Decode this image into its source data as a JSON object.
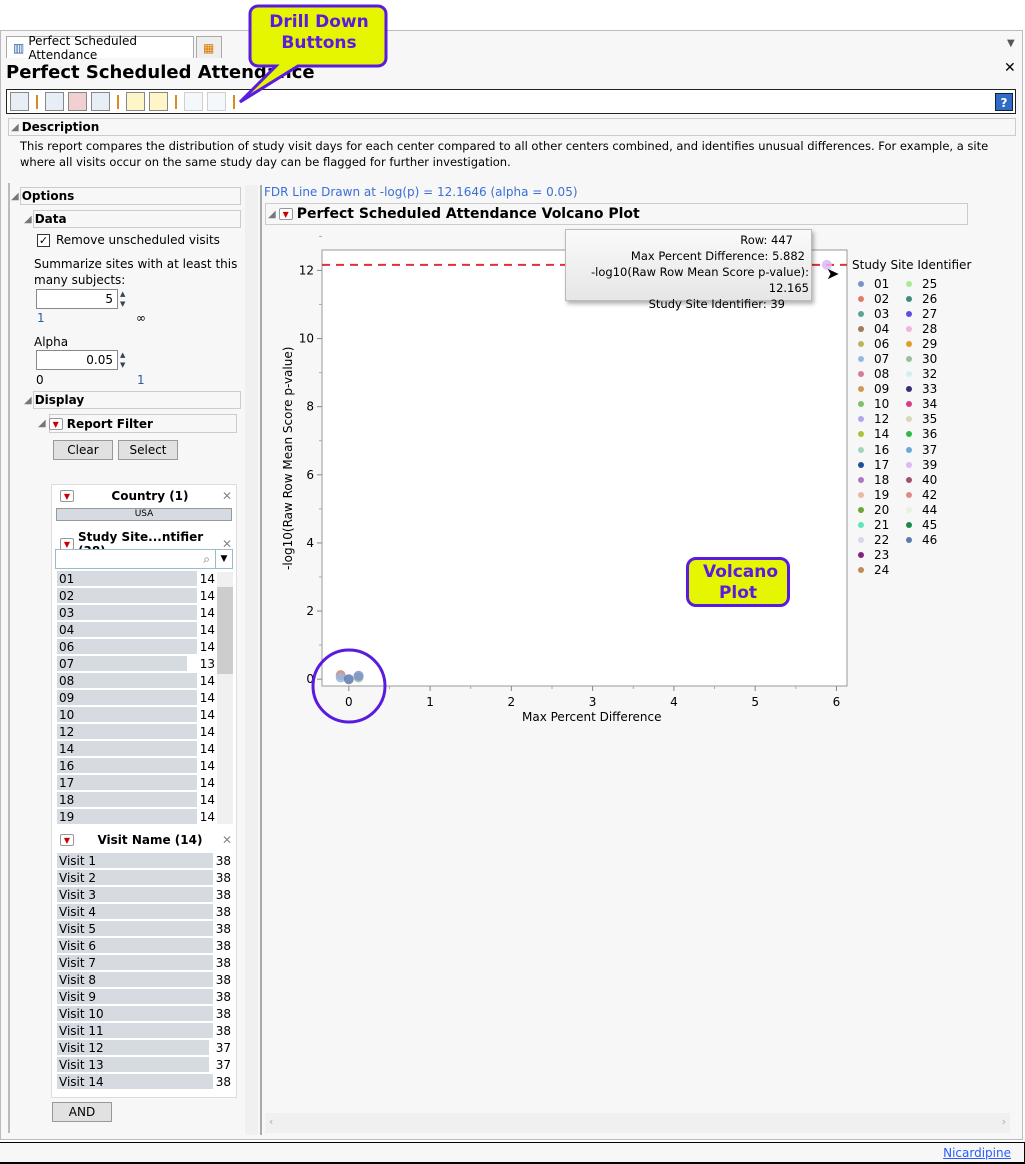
{
  "tabs": [
    {
      "label": "Perfect Scheduled Attendance",
      "icon": "report-icon"
    },
    {
      "label": "",
      "icon": "chart-icon"
    }
  ],
  "title": "Perfect Scheduled Attendance",
  "toolbar": {
    "buttons": [
      "export-icon",
      "data-table-icon",
      "subset-icon",
      "review-icon",
      "add-note-icon",
      "view-notes-icon",
      "drill-filter-icon",
      "drill-graph-icon"
    ],
    "help": "?"
  },
  "description": {
    "header": "Description",
    "text": "This report compares the distribution of study visit days for each center compared to all other centers combined, and identifies unusual differences. For example, a site where all visits occur on the same study day can be flagged for further investigation."
  },
  "options": {
    "header": "Options",
    "data_header": "Data",
    "remove_unscheduled": "Remove unscheduled visits",
    "summarize_label": "Summarize sites with at least this many subjects:",
    "summarize_value": "5",
    "summarize_min": "1",
    "summarize_max": "∞",
    "alpha_label": "Alpha",
    "alpha_value": "0.05",
    "alpha_min": "0",
    "alpha_max": "1",
    "display_header": "Display",
    "report_filter": "Report Filter",
    "clear": "Clear",
    "select": "Select"
  },
  "filters": {
    "country": {
      "title": "Country (1)",
      "values": [
        "USA"
      ]
    },
    "site": {
      "title": "Study Site...ntifier (38)",
      "search_placeholder": "",
      "items": [
        [
          "01",
          14
        ],
        [
          "02",
          14
        ],
        [
          "03",
          14
        ],
        [
          "04",
          14
        ],
        [
          "06",
          14
        ],
        [
          "07",
          13
        ],
        [
          "08",
          14
        ],
        [
          "09",
          14
        ],
        [
          "10",
          14
        ],
        [
          "12",
          14
        ],
        [
          "14",
          14
        ],
        [
          "16",
          14
        ],
        [
          "17",
          14
        ],
        [
          "18",
          14
        ],
        [
          "19",
          14
        ]
      ]
    },
    "visit": {
      "title": "Visit Name (14)",
      "items": [
        [
          "Visit 1",
          38
        ],
        [
          "Visit 2",
          38
        ],
        [
          "Visit 3",
          38
        ],
        [
          "Visit 4",
          38
        ],
        [
          "Visit 5",
          38
        ],
        [
          "Visit 6",
          38
        ],
        [
          "Visit 7",
          38
        ],
        [
          "Visit 8",
          38
        ],
        [
          "Visit 9",
          38
        ],
        [
          "Visit 10",
          38
        ],
        [
          "Visit 11",
          38
        ],
        [
          "Visit 12",
          37
        ],
        [
          "Visit 13",
          37
        ],
        [
          "Visit 14",
          38
        ]
      ]
    },
    "and": "AND"
  },
  "fdr_text": "FDR Line Drawn at -log(p) = 12.1646 (alpha = 0.05)",
  "plot_header": "Perfect Scheduled Attendance Volcano Plot",
  "tooltip": {
    "row": "Row:  447",
    "mpd": "Max Percent Difference: 5.882",
    "logp": "-log10(Raw Row Mean Score p-value): 12.165",
    "site": "Study Site Identifier: 39"
  },
  "chart_data": {
    "type": "scatter",
    "xlabel": "Max Percent Difference",
    "ylabel": "-log10(Raw Row Mean Score p-value)",
    "xlim": [
      -0.33,
      6.13
    ],
    "ylim": [
      -0.2,
      12.6
    ],
    "xticks": [
      0,
      1,
      2,
      3,
      4,
      5,
      6
    ],
    "yticks": [
      0,
      2,
      4,
      6,
      8,
      10,
      12
    ],
    "fdr_line": 12.1646,
    "points": [
      {
        "x": -0.1,
        "y": 0.12,
        "site": "02"
      },
      {
        "x": -0.1,
        "y": 0.05,
        "site": "07"
      },
      {
        "x": 0.0,
        "y": 0.0,
        "site": "46"
      },
      {
        "x": 0.12,
        "y": 0.05,
        "site": "30"
      },
      {
        "x": 0.12,
        "y": 0.1,
        "site": "01"
      },
      {
        "x": 5.882,
        "y": 12.165,
        "site": "39"
      }
    ],
    "legend_title": "Study Site Identifier",
    "legend": [
      [
        "01",
        "#7b93c9"
      ],
      [
        "02",
        "#e07b6a"
      ],
      [
        "03",
        "#5aa39a"
      ],
      [
        "04",
        "#a07c5a"
      ],
      [
        "06",
        "#b9b65a"
      ],
      [
        "07",
        "#93b9e0"
      ],
      [
        "08",
        "#d57aa0"
      ],
      [
        "09",
        "#d09a50"
      ],
      [
        "10",
        "#7cc06a"
      ],
      [
        "12",
        "#b0a5ee"
      ],
      [
        "14",
        "#a9c23a"
      ],
      [
        "16",
        "#9ed6bd"
      ],
      [
        "17",
        "#1f4e9e"
      ],
      [
        "18",
        "#aa78c0"
      ],
      [
        "19",
        "#eab7a8"
      ],
      [
        "20",
        "#6ea43a"
      ],
      [
        "21",
        "#5ae8b7"
      ],
      [
        "22",
        "#d4d9ea"
      ],
      [
        "23",
        "#8a1f7c"
      ],
      [
        "24",
        "#c08a5a"
      ],
      [
        "25",
        "#a9eb95"
      ],
      [
        "26",
        "#3f8c7d"
      ],
      [
        "27",
        "#5b4ee0"
      ],
      [
        "28",
        "#f0b5dd"
      ],
      [
        "29",
        "#e0a020"
      ],
      [
        "30",
        "#99c09b"
      ],
      [
        "32",
        "#d3eef2"
      ],
      [
        "33",
        "#3d2a78"
      ],
      [
        "34",
        "#e03a80"
      ],
      [
        "35",
        "#d8d8b8"
      ],
      [
        "36",
        "#2eb84a"
      ],
      [
        "37",
        "#6aa9d6"
      ],
      [
        "39",
        "#ddb8f4"
      ],
      [
        "40",
        "#a05070"
      ],
      [
        "42",
        "#e08a88"
      ],
      [
        "44",
        "#eaf0dc"
      ],
      [
        "45",
        "#1a8a4a"
      ],
      [
        "46",
        "#5c7ab0"
      ]
    ]
  },
  "callouts": {
    "drill": "Drill Down Buttons",
    "volcano": "Volcano Plot"
  },
  "status_link": "Nicardipine"
}
